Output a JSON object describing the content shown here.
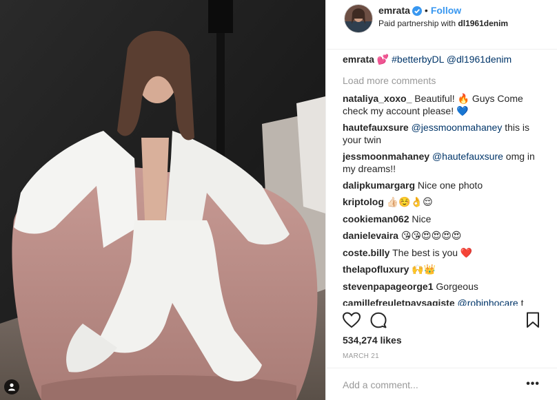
{
  "post": {
    "username": "emrata",
    "follow_label": "Follow",
    "dot": "•",
    "partnership_prefix": "Paid partnership with",
    "partnership_brand": "dl1961denim",
    "caption": {
      "user": "emrata",
      "emoji": "💕",
      "hashtag": "#betterbyDL",
      "mention": "@dl1961denim"
    },
    "load_more": "Load more comments",
    "comments": [
      {
        "user": "nataliya_xoxo_",
        "text": "Beautiful! 🔥 Guys Come check my account please! 💙"
      },
      {
        "user": "hautefauxsure",
        "mention": "@jessmoonmahaney",
        "text": "this is your twin"
      },
      {
        "user": "jessmoonmahaney",
        "mention": "@hautefauxsure",
        "text": "omg in my dreams!!"
      },
      {
        "user": "dalipkumargarg",
        "text": "Nice one photo"
      },
      {
        "user": "kriptolog",
        "text": "👍🏻☺️👌😌"
      },
      {
        "user": "cookieman062",
        "text": "Nice"
      },
      {
        "user": "danielevaira",
        "text": "😘😘😍😍😍😍"
      },
      {
        "user": "coste.billy",
        "text": "The best is you ❤️"
      },
      {
        "user": "thelapofluxury",
        "text": "🙌👑"
      },
      {
        "user": "stevenpapageorge1",
        "text": "Gorgeous"
      },
      {
        "user": "camillefreuletpaysagiste",
        "mention": "@robinhocare",
        "text": "t"
      }
    ],
    "likes": "534,274 likes",
    "date": "MARCH 21",
    "add_comment_placeholder": "Add a comment...",
    "more_options": "•••"
  },
  "icons": {
    "verified": "verified-badge-icon",
    "like": "heart-outline-icon",
    "comment": "speech-bubble-icon",
    "save": "bookmark-icon",
    "tagged": "person-tag-icon"
  },
  "colors": {
    "link_blue": "#3897f0",
    "mention_blue": "#003569",
    "muted_gray": "#999999",
    "text": "#262626"
  }
}
